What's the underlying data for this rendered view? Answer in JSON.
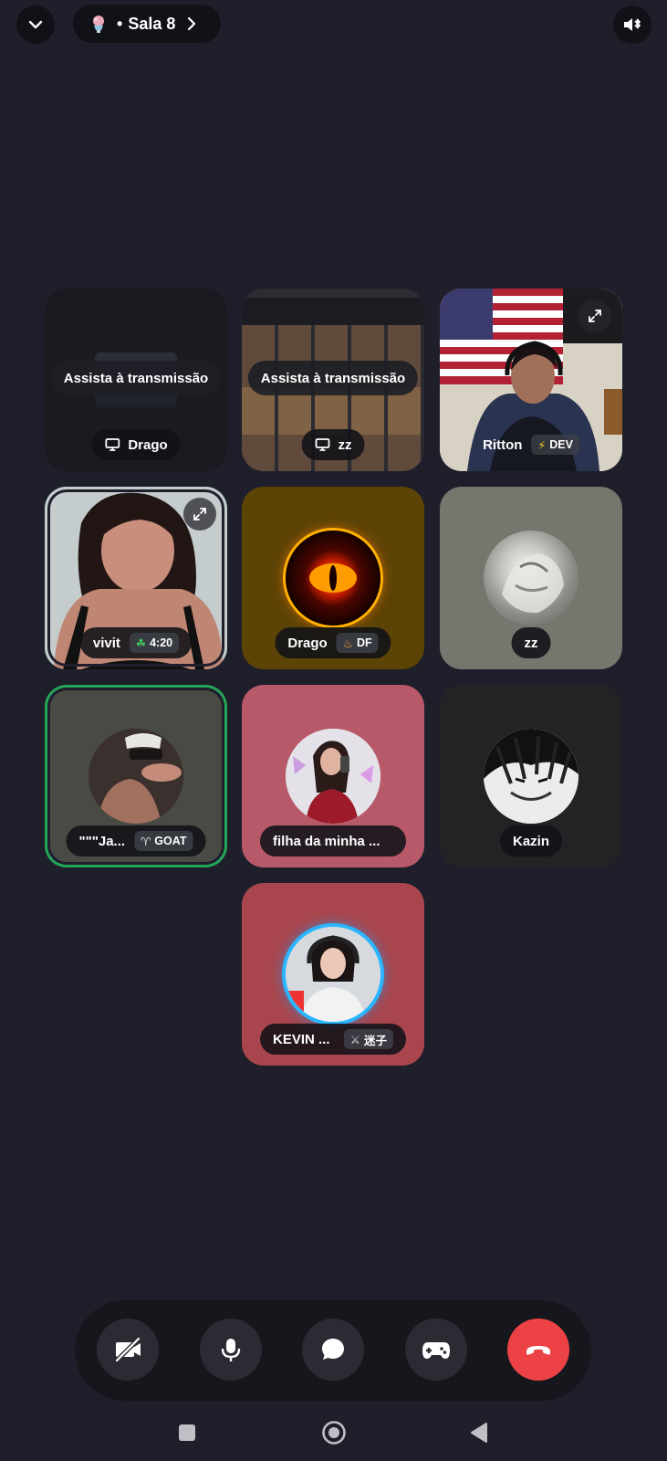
{
  "header": {
    "channel_name": "Sala 8",
    "separator": "•"
  },
  "tiles": [
    {
      "name": "Drago",
      "type": "stream",
      "watch_label": "Assista à transmissão",
      "bg": "#1a1b20"
    },
    {
      "name": "zz",
      "type": "stream",
      "watch_label": "Assista à transmissão",
      "bg": "#2a2b30"
    },
    {
      "name": "Ritton",
      "type": "video",
      "badge": "DEV",
      "badge_icon": "lightning-icon"
    },
    {
      "name": "vivit",
      "type": "video",
      "speaking": true,
      "badge": "4:20",
      "badge_icon": "leaf-icon"
    },
    {
      "name": "Drago",
      "type": "avatar",
      "bg": "#5c4306",
      "badge": "DF",
      "badge_icon": "fire-icon"
    },
    {
      "name": "zz",
      "type": "avatar",
      "bg": "#76766e"
    },
    {
      "name": "\"\"\"Ja...",
      "type": "avatar",
      "speaking": true,
      "bg": "#484a44",
      "badge": "GOAT",
      "badge_icon": "goat-icon"
    },
    {
      "name": "filha da minha ...",
      "type": "avatar",
      "bg": "#b75969"
    },
    {
      "name": "Kazin",
      "type": "avatar",
      "bg": "#222325"
    },
    {
      "name": "KEVIN ...",
      "type": "avatar",
      "bg": "#a9464d",
      "badge": "迷子",
      "badge_icon": "sword-icon"
    }
  ],
  "controls": [
    {
      "name": "camera-off-button",
      "icon": "camera-off-icon"
    },
    {
      "name": "microphone-button",
      "icon": "microphone-icon"
    },
    {
      "name": "chat-button",
      "icon": "chat-bubble-icon"
    },
    {
      "name": "activities-button",
      "icon": "gamepad-icon"
    },
    {
      "name": "disconnect-button",
      "icon": "phone-hangup-icon",
      "color": "#ed4245"
    }
  ],
  "colors": {
    "background": "#1e1f2a",
    "speaking_ring": "#23a55a",
    "end_call": "#ed4245"
  }
}
